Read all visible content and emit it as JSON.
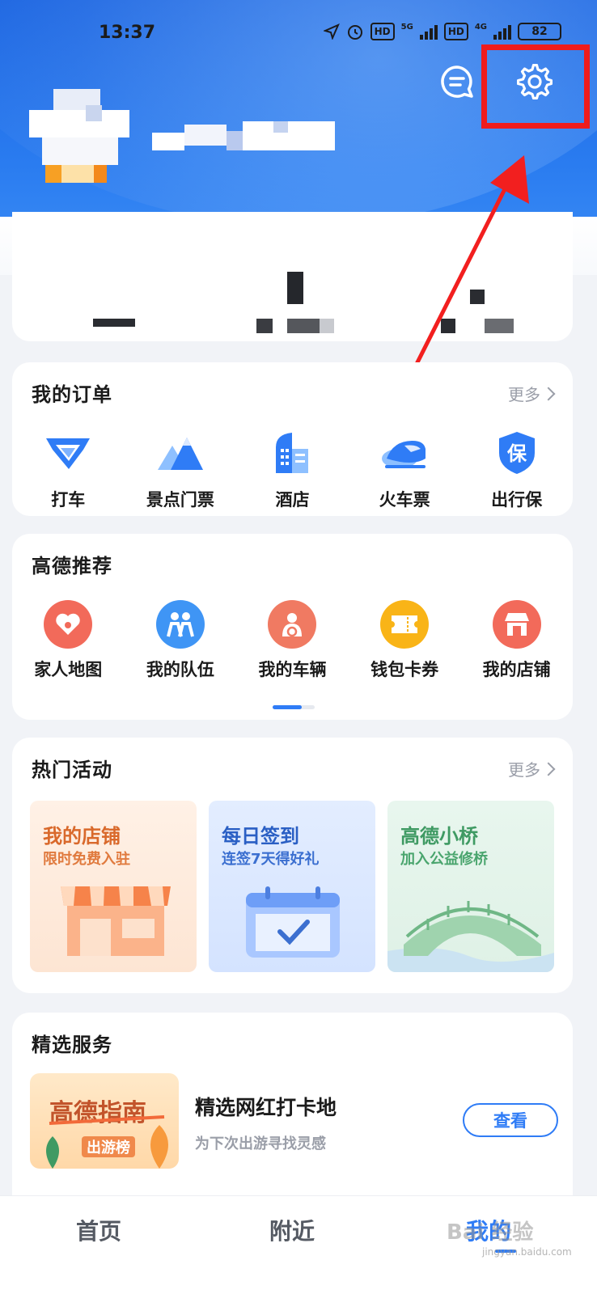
{
  "status_bar": {
    "time": "13:37",
    "hd1": "HD",
    "net1": "5G",
    "hd2": "HD",
    "net2": "4G",
    "battery": "82"
  },
  "header": {
    "message_icon": "message-icon",
    "settings_icon": "gear-icon",
    "highlight_color": "#ef1c1c"
  },
  "orders": {
    "title": "我的订单",
    "more": "更多",
    "items": [
      {
        "label": "打车",
        "icon": "taxi-icon"
      },
      {
        "label": "景点门票",
        "icon": "mountain-icon"
      },
      {
        "label": "酒店",
        "icon": "hotel-icon"
      },
      {
        "label": "火车票",
        "icon": "train-icon"
      },
      {
        "label": "出行保",
        "icon": "shield-icon",
        "glyph": "保"
      }
    ]
  },
  "recommend": {
    "title": "高德推荐",
    "items": [
      {
        "label": "家人地图",
        "icon": "heart-icon",
        "color": "#f26a5a"
      },
      {
        "label": "我的队伍",
        "icon": "team-icon",
        "color": "#3f95f5"
      },
      {
        "label": "我的车辆",
        "icon": "driver-icon",
        "color": "#f07a62"
      },
      {
        "label": "钱包卡券",
        "icon": "ticket-icon",
        "color": "#f9b417"
      },
      {
        "label": "我的店铺",
        "icon": "shop-icon",
        "color": "#f26a5a"
      }
    ]
  },
  "activities": {
    "title": "热门活动",
    "more": "更多",
    "tiles": [
      {
        "title": "我的店铺",
        "sub": "限时免费入驻",
        "color": "#d9692b"
      },
      {
        "title": "每日签到",
        "sub": "连签7天得好礼",
        "color": "#2a5fc4"
      },
      {
        "title": "高德小桥",
        "sub": "加入公益修桥",
        "color": "#3f9a63"
      }
    ]
  },
  "services": {
    "title": "精选服务",
    "thumb_title": "高德指南",
    "thumb_sub": "出游榜",
    "item_title": "精选网红打卡地",
    "item_sub": "为下次出游寻找灵感",
    "button": "查看"
  },
  "bottom_nav": {
    "home": "首页",
    "nearby": "附近",
    "mine": "我的",
    "watermark": "Bai 经验",
    "watermark_url": "jingyan.baidu.com"
  }
}
